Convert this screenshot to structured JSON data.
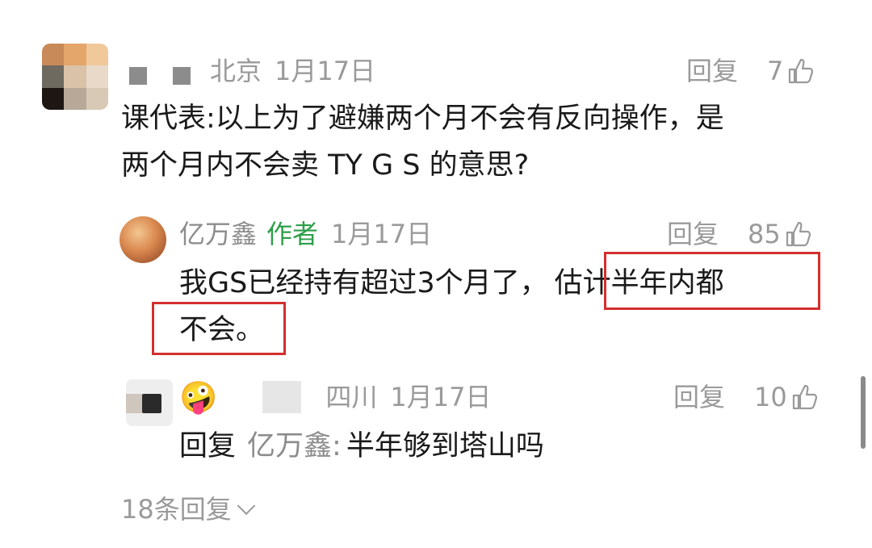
{
  "comments": [
    {
      "location": "北京",
      "date": "1月17日",
      "reply_label": "回复",
      "likes": "7",
      "text_lines": [
        "课代表:以上为了避嫌两个月不会有反向操作，是",
        "两个月内不会卖 TY G S 的意思?"
      ]
    }
  ],
  "replies": [
    {
      "username": "亿万鑫",
      "author_tag": "作者",
      "date": "1月17日",
      "reply_label": "回复",
      "likes": "85",
      "text_line1_a": "我GS已经持有超过3个月了，",
      "text_line1_b": "估计半年内都",
      "text_line2": "不会。"
    },
    {
      "location": "四川",
      "date": "1月17日",
      "reply_label": "回复",
      "likes": "10",
      "reply_prefix": "回复",
      "reply_to": "亿万鑫:",
      "text": "半年够到塔山吗"
    }
  ],
  "more_replies": "18条回复",
  "colors": {
    "highlight": "#d32f2f",
    "author_tag": "#2e9e4a",
    "meta": "#9a9a9a"
  }
}
